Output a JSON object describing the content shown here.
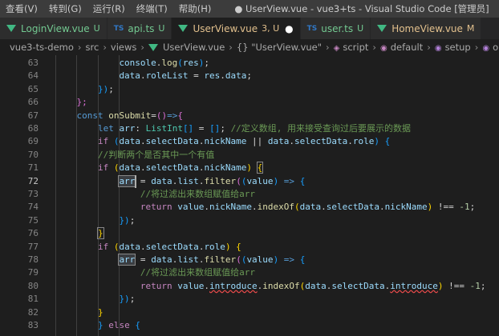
{
  "menu": [
    "查看(V)",
    "转到(G)",
    "运行(R)",
    "终端(T)",
    "帮助(H)"
  ],
  "window_title": "● UserView.vue - vue3+ts - Visual Studio Code [管理员]",
  "tabs": [
    {
      "icon": "vue",
      "name": "LoginView.vue",
      "status": "U"
    },
    {
      "icon": "ts",
      "name": "api.ts",
      "status": "U"
    },
    {
      "icon": "vue",
      "name": "UserView.vue",
      "status": "3, U",
      "active": true,
      "dirty": "●"
    },
    {
      "icon": "ts",
      "name": "user.ts",
      "status": "U"
    },
    {
      "icon": "vue",
      "name": "HomeView.vue",
      "status": "M"
    }
  ],
  "ts_label": "TS",
  "breadcrumb": [
    "vue3-ts-demo",
    "src",
    "views",
    "UserView.vue",
    "{} \"UserView.vue\"",
    "script",
    "default",
    "setup",
    "onSubmit"
  ],
  "editor": {
    "current_line": "72",
    "lines": [
      {
        "n": "63",
        "indent": 3,
        "t": [
          [
            "console",
            "var"
          ],
          [
            ".",
            "p"
          ],
          [
            "log",
            "fn"
          ],
          [
            "(",
            "b3"
          ],
          [
            "res",
            "var"
          ],
          [
            ")",
            "b3"
          ],
          [
            ";",
            "p"
          ]
        ]
      },
      {
        "n": "64",
        "indent": 3,
        "t": [
          [
            "data",
            "var"
          ],
          [
            ".",
            "p"
          ],
          [
            "roleList",
            "var"
          ],
          [
            " = ",
            "p"
          ],
          [
            "res",
            "var"
          ],
          [
            ".",
            "p"
          ],
          [
            "data",
            "var"
          ],
          [
            ";",
            "p"
          ]
        ]
      },
      {
        "n": "65",
        "indent": 2,
        "t": [
          [
            "})",
            "b3"
          ],
          [
            ";",
            "p"
          ]
        ]
      },
      {
        "n": "66",
        "indent": 1,
        "t": [
          [
            "};",
            "b2"
          ]
        ]
      },
      {
        "n": "67",
        "indent": 1,
        "t": [
          [
            "const ",
            "kw"
          ],
          [
            "onSubmit",
            "fn"
          ],
          [
            "=",
            "p"
          ],
          [
            "()",
            "b2"
          ],
          [
            "=>",
            "kw"
          ],
          [
            "{",
            "b2"
          ]
        ]
      },
      {
        "n": "68",
        "indent": 2,
        "t": [
          [
            "let ",
            "kw"
          ],
          [
            "arr",
            "var"
          ],
          [
            ": ",
            "p"
          ],
          [
            "ListInt",
            "type"
          ],
          [
            "[]",
            "b3"
          ],
          [
            " = ",
            "p"
          ],
          [
            "[]",
            "b3"
          ],
          [
            "; ",
            "p"
          ],
          [
            "//定义数组, 用来接受查询过后要展示的数据",
            "cmt"
          ]
        ]
      },
      {
        "n": "69",
        "indent": 2,
        "t": [
          [
            "if ",
            "ctrl"
          ],
          [
            "(",
            "b3"
          ],
          [
            "data",
            "var"
          ],
          [
            ".",
            "p"
          ],
          [
            "selectData",
            "var"
          ],
          [
            ".",
            "p"
          ],
          [
            "nickName",
            "var"
          ],
          [
            " || ",
            "p"
          ],
          [
            "data",
            "var"
          ],
          [
            ".",
            "p"
          ],
          [
            "selectData",
            "var"
          ],
          [
            ".",
            "p"
          ],
          [
            "role",
            "var"
          ],
          [
            ")",
            "b3"
          ],
          [
            " {",
            "b3"
          ]
        ]
      },
      {
        "n": "70",
        "indent": 2,
        "t": [
          [
            "//判断两个是否其中一个有值",
            "cmt"
          ]
        ]
      },
      {
        "n": "71",
        "indent": 2,
        "t": [
          [
            "if ",
            "ctrl"
          ],
          [
            "(",
            "b1"
          ],
          [
            "data",
            "var"
          ],
          [
            ".",
            "p"
          ],
          [
            "selectData",
            "var"
          ],
          [
            ".",
            "p"
          ],
          [
            "nickName",
            "var"
          ],
          [
            ")",
            "b1"
          ],
          [
            " ",
            "p"
          ],
          [
            "{",
            "b1box"
          ]
        ]
      },
      {
        "n": "72",
        "indent": 3,
        "t": [
          [
            "arr",
            "varhl"
          ],
          [
            " = ",
            "p"
          ],
          [
            "data",
            "var"
          ],
          [
            ".",
            "p"
          ],
          [
            "list",
            "var"
          ],
          [
            ".",
            "p"
          ],
          [
            "filter",
            "fn"
          ],
          [
            "(",
            "b2"
          ],
          [
            "(",
            "b3"
          ],
          [
            "value",
            "var"
          ],
          [
            ")",
            "b3"
          ],
          [
            " => ",
            "kw"
          ],
          [
            "{",
            "b3"
          ]
        ]
      },
      {
        "n": "73",
        "indent": 4,
        "t": [
          [
            "//将过滤出来数组赋值给arr",
            "cmt"
          ]
        ]
      },
      {
        "n": "74",
        "indent": 4,
        "t": [
          [
            "return ",
            "ctrl"
          ],
          [
            "value",
            "var"
          ],
          [
            ".",
            "p"
          ],
          [
            "nickName",
            "var"
          ],
          [
            ".",
            "p"
          ],
          [
            "indexOf",
            "fn"
          ],
          [
            "(",
            "b1"
          ],
          [
            "data",
            "var"
          ],
          [
            ".",
            "p"
          ],
          [
            "selectData",
            "var"
          ],
          [
            ".",
            "p"
          ],
          [
            "nickName",
            "var"
          ],
          [
            ")",
            "b1"
          ],
          [
            " !== ",
            "p"
          ],
          [
            "-1",
            "num"
          ],
          [
            ";",
            "p"
          ]
        ]
      },
      {
        "n": "75",
        "indent": 3,
        "t": [
          [
            "})",
            "b3"
          ],
          [
            ";",
            "p"
          ]
        ]
      },
      {
        "n": "76",
        "indent": 2,
        "t": [
          [
            "}",
            "b1box"
          ]
        ]
      },
      {
        "n": "77",
        "indent": 2,
        "t": [
          [
            "if ",
            "ctrl"
          ],
          [
            "(",
            "b1"
          ],
          [
            "data",
            "var"
          ],
          [
            ".",
            "p"
          ],
          [
            "selectData",
            "var"
          ],
          [
            ".",
            "p"
          ],
          [
            "role",
            "var"
          ],
          [
            ")",
            "b1"
          ],
          [
            " {",
            "b1"
          ]
        ]
      },
      {
        "n": "78",
        "indent": 3,
        "t": [
          [
            "arr",
            "varhl"
          ],
          [
            " = ",
            "p"
          ],
          [
            "data",
            "var"
          ],
          [
            ".",
            "p"
          ],
          [
            "list",
            "var"
          ],
          [
            ".",
            "p"
          ],
          [
            "filter",
            "fn"
          ],
          [
            "(",
            "b2"
          ],
          [
            "(",
            "b3"
          ],
          [
            "value",
            "var"
          ],
          [
            ")",
            "b3"
          ],
          [
            " => ",
            "kw"
          ],
          [
            "{",
            "b3"
          ]
        ]
      },
      {
        "n": "79",
        "indent": 4,
        "t": [
          [
            "//将过滤出来数组赋值给arr",
            "cmt"
          ]
        ]
      },
      {
        "n": "80",
        "indent": 4,
        "t": [
          [
            "return ",
            "ctrl"
          ],
          [
            "value",
            "var"
          ],
          [
            ".",
            "p"
          ],
          [
            "introduce",
            "varerr"
          ],
          [
            ".",
            "p"
          ],
          [
            "indexOf",
            "fn"
          ],
          [
            "(",
            "b1"
          ],
          [
            "data",
            "var"
          ],
          [
            ".",
            "p"
          ],
          [
            "selectData",
            "var"
          ],
          [
            ".",
            "p"
          ],
          [
            "introduce",
            "varerr"
          ],
          [
            ")",
            "b1"
          ],
          [
            " !== ",
            "p"
          ],
          [
            "-1",
            "num"
          ],
          [
            ";",
            "p"
          ]
        ]
      },
      {
        "n": "81",
        "indent": 3,
        "t": [
          [
            "})",
            "b3"
          ],
          [
            ";",
            "p"
          ]
        ]
      },
      {
        "n": "82",
        "indent": 2,
        "t": [
          [
            "}",
            "b1"
          ]
        ]
      },
      {
        "n": "83",
        "indent": 2,
        "t": [
          [
            "} ",
            "b3"
          ],
          [
            "else ",
            "ctrl"
          ],
          [
            "{",
            "b3"
          ]
        ]
      }
    ]
  }
}
